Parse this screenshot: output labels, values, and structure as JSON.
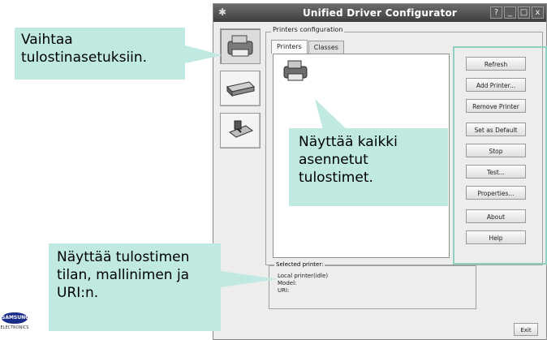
{
  "window": {
    "title": "Unified Driver Configurator",
    "controls": [
      "?",
      "_",
      "□",
      "x"
    ]
  },
  "nav": {
    "items": [
      {
        "name": "printer-configuration",
        "icon": "printer-icon"
      },
      {
        "name": "scanner-configuration",
        "icon": "scanner-icon"
      },
      {
        "name": "port-configuration",
        "icon": "port-icon"
      }
    ]
  },
  "printers_config": {
    "group_title": "Printers configuration",
    "tabs": [
      "Printers",
      "Classes"
    ],
    "buttons": [
      "Refresh",
      "Add Printer...",
      "Remove Printer",
      "Set as Default",
      "Stop",
      "Test...",
      "Properties...",
      "About",
      "Help"
    ]
  },
  "selected_printer": {
    "legend": "Selected printer:",
    "lines": [
      "Local printer(idle)",
      "Model:",
      "URI:"
    ]
  },
  "footer": {
    "exit_label": "Exit",
    "logo_text": "SAMSUNG",
    "logo_sub": "ELECTRONICS"
  },
  "callouts": {
    "settings": "Vaihtaa tulostinasetuksiin.",
    "printers": "Näyttää kaikki asennetut tulostimet.",
    "status": "Näyttää tulostimen tilan, mallinimen ja URI:n."
  },
  "colors": {
    "callout_bg": "#bfe9e1",
    "frame": "#8fd0c3",
    "titlebar": "#4a4a4a"
  }
}
